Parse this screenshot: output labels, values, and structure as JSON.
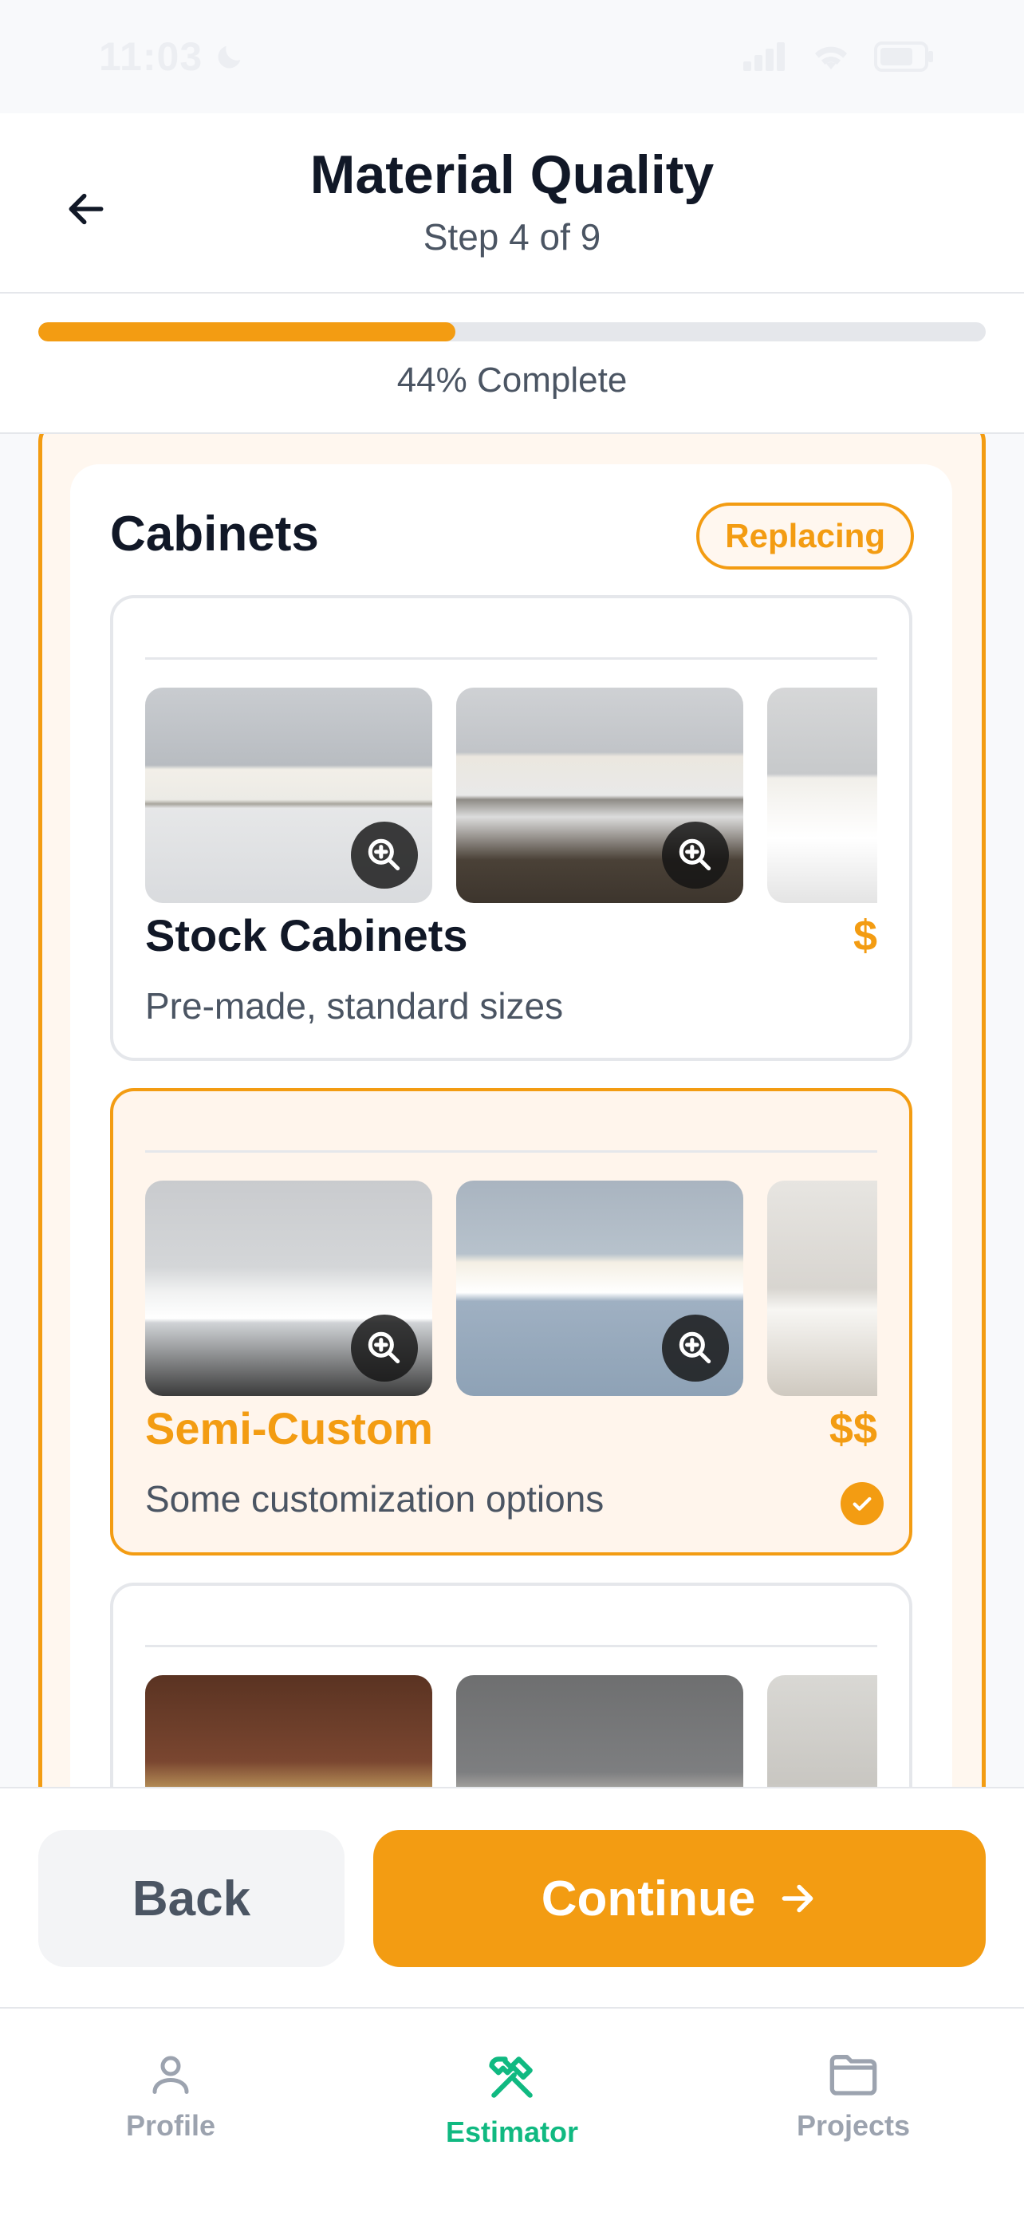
{
  "status_bar": {
    "time": "11:03"
  },
  "header": {
    "title": "Material Quality",
    "step": "Step 4 of 9"
  },
  "progress": {
    "percent": 44,
    "label": "44% Complete"
  },
  "section": {
    "title": "Cabinets",
    "badge": "Replacing",
    "options": [
      {
        "name": "Stock Cabinets",
        "price": "$",
        "description": "Pre-made, standard sizes",
        "selected": false
      },
      {
        "name": "Semi-Custom",
        "price": "$$",
        "description": "Some customization options",
        "selected": true
      },
      {
        "name": "",
        "price": "",
        "description": "",
        "selected": false
      }
    ]
  },
  "actions": {
    "back_label": "Back",
    "continue_label": "Continue"
  },
  "tabs": [
    {
      "label": "Profile",
      "icon": "person-icon",
      "active": false
    },
    {
      "label": "Estimator",
      "icon": "tools-icon",
      "active": true
    },
    {
      "label": "Projects",
      "icon": "folder-icon",
      "active": false
    }
  ],
  "colors": {
    "accent": "#f39c12",
    "active_tab": "#10b981",
    "text": "#111827",
    "muted": "#4b5563"
  }
}
